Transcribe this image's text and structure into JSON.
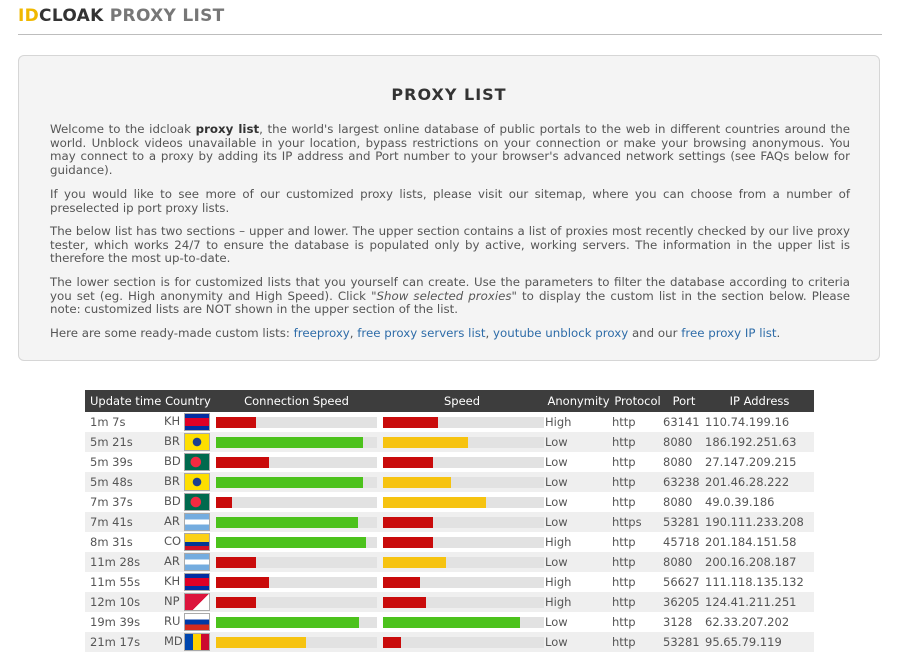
{
  "header": {
    "logo_part1": "ID",
    "logo_part2": "CLOAK",
    "logo_part3": " PROXY LIST"
  },
  "intro": {
    "title": "PROXY LIST",
    "p1_a": "Welcome to the idcloak ",
    "p1_b": "proxy list",
    "p1_c": ", the world's largest online database of public portals to the web in different countries around the world. Unblock videos unavailable in your location, bypass restrictions on your connection or make your browsing anonymous. You may connect to a proxy by adding its IP address and Port number to your browser's advanced network settings (see FAQs below for guidance).",
    "p2": "If you would like to see more of our customized proxy lists, please visit our sitemap, where you can choose from a number of preselected ip port proxy lists.",
    "p3": "The below list has two sections – upper and lower. The upper section contains a list of proxies most recently checked by our live proxy tester, which works 24/7 to ensure the database is populated only by active, working servers. The information in the upper list is therefore the most up-to-date.",
    "p4_a": "The lower section is for customized lists that you yourself can create. Use the parameters to filter the database according to criteria you set (eg. High anonymity and High Speed). Click ",
    "p4_b": "\"Show selected proxies\"",
    "p4_c": " to display the custom list in the section below. Please note: customized lists are NOT shown in the upper section of the list.",
    "p5_a": "Here are some ready-made custom lists: ",
    "link1": "freeproxy",
    "sep1": ", ",
    "link2": "free proxy servers list",
    "sep2": ", ",
    "link3": "youtube unblock proxy",
    "p5_b": " and our ",
    "link4": "free proxy IP list",
    "p5_c": "."
  },
  "table": {
    "columns": [
      "Update time",
      "Country",
      "Connection Speed",
      "Speed",
      "Anonymity",
      "Protocol",
      "Port",
      "IP Address"
    ],
    "rows": [
      {
        "time": "1m 7s",
        "country": "KH",
        "conn": 0.25,
        "conn_color": "red",
        "speed": 0.34,
        "speed_color": "red",
        "anon": "High",
        "proto": "http",
        "port": "63141",
        "ip": "110.74.199.16"
      },
      {
        "time": "5m 21s",
        "country": "BR",
        "conn": 0.91,
        "conn_color": "green",
        "speed": 0.53,
        "speed_color": "yellow",
        "anon": "Low",
        "proto": "http",
        "port": "8080",
        "ip": "186.192.251.63"
      },
      {
        "time": "5m 39s",
        "country": "BD",
        "conn": 0.33,
        "conn_color": "red",
        "speed": 0.31,
        "speed_color": "red",
        "anon": "Low",
        "proto": "http",
        "port": "8080",
        "ip": "27.147.209.215"
      },
      {
        "time": "5m 48s",
        "country": "BR",
        "conn": 0.91,
        "conn_color": "green",
        "speed": 0.42,
        "speed_color": "yellow",
        "anon": "Low",
        "proto": "http",
        "port": "63238",
        "ip": "201.46.28.222"
      },
      {
        "time": "7m 37s",
        "country": "BD",
        "conn": 0.1,
        "conn_color": "red",
        "speed": 0.64,
        "speed_color": "yellow",
        "anon": "Low",
        "proto": "http",
        "port": "8080",
        "ip": "49.0.39.186"
      },
      {
        "time": "7m 41s",
        "country": "AR",
        "conn": 0.88,
        "conn_color": "green",
        "speed": 0.31,
        "speed_color": "red",
        "anon": "Low",
        "proto": "https",
        "port": "53281",
        "ip": "190.111.233.208"
      },
      {
        "time": "8m 31s",
        "country": "CO",
        "conn": 0.93,
        "conn_color": "green",
        "speed": 0.31,
        "speed_color": "red",
        "anon": "High",
        "proto": "http",
        "port": "45718",
        "ip": "201.184.151.58"
      },
      {
        "time": "11m 28s",
        "country": "AR",
        "conn": 0.25,
        "conn_color": "red",
        "speed": 0.39,
        "speed_color": "yellow",
        "anon": "Low",
        "proto": "http",
        "port": "8080",
        "ip": "200.16.208.187"
      },
      {
        "time": "11m 55s",
        "country": "KH",
        "conn": 0.33,
        "conn_color": "red",
        "speed": 0.23,
        "speed_color": "red",
        "anon": "High",
        "proto": "http",
        "port": "56627",
        "ip": "111.118.135.132"
      },
      {
        "time": "12m 10s",
        "country": "NP",
        "conn": 0.25,
        "conn_color": "red",
        "speed": 0.27,
        "speed_color": "red",
        "anon": "High",
        "proto": "http",
        "port": "36205",
        "ip": "124.41.211.251"
      },
      {
        "time": "19m 39s",
        "country": "RU",
        "conn": 0.89,
        "conn_color": "green",
        "speed": 0.85,
        "speed_color": "green",
        "anon": "Low",
        "proto": "http",
        "port": "3128",
        "ip": "62.33.207.202"
      },
      {
        "time": "21m 17s",
        "country": "MD",
        "conn": 0.56,
        "conn_color": "yellow",
        "speed": 0.11,
        "speed_color": "red",
        "anon": "Low",
        "proto": "http",
        "port": "53281",
        "ip": "95.65.79.119"
      }
    ]
  }
}
